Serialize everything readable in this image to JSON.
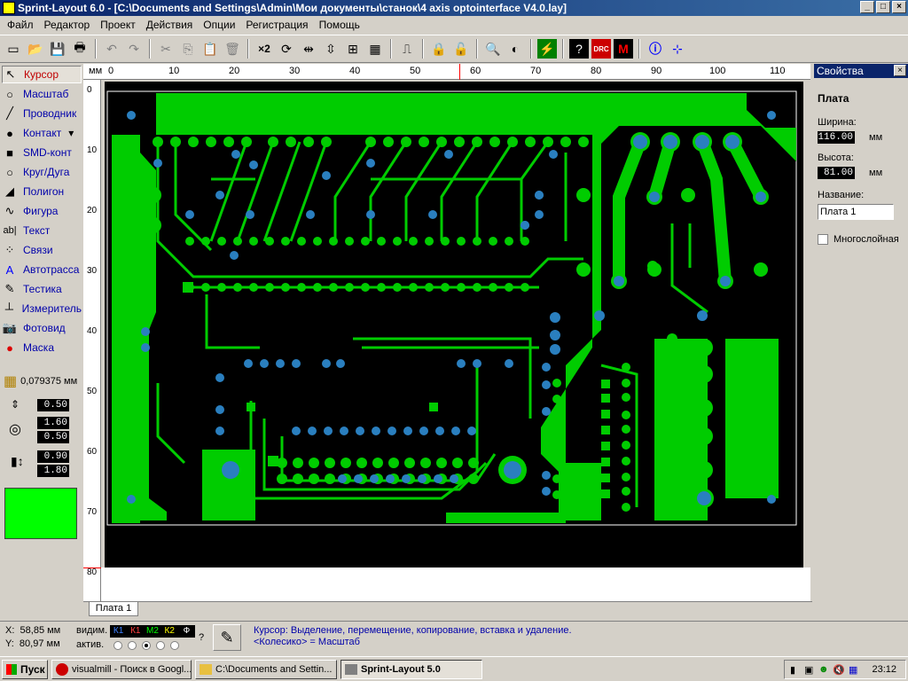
{
  "window": {
    "title": "Sprint-Layout 6.0 - [C:\\Documents and Settings\\Admin\\Мои документы\\станок\\4 axis optointerface V4.0.lay]"
  },
  "menu": [
    "Файл",
    "Редактор",
    "Проект",
    "Действия",
    "Опции",
    "Регистрация",
    "Помощь"
  ],
  "toolbar": [
    "new-icon",
    "open-icon",
    "save-icon",
    "print-icon",
    "undo-icon",
    "redo-icon",
    "cut-icon",
    "copy-icon",
    "paste-icon",
    "delete-icon",
    "x2",
    "rotate-icon",
    "mirror-h-icon",
    "mirror-v-icon",
    "align-icon",
    "group-icon",
    "fixed-icon",
    "lock-icon",
    "unlock-icon",
    "zoom-icon",
    "contrast-icon",
    "autoroute-icon",
    "photoview-icon",
    "drc-icon",
    "macro-icon",
    "info-icon",
    "net-icon"
  ],
  "toolbar_x2": "×2",
  "tools": [
    {
      "label": "Курсор",
      "icon": "cursor-icon"
    },
    {
      "label": "Масштаб",
      "icon": "zoom-icon"
    },
    {
      "label": "Проводник",
      "icon": "track-icon"
    },
    {
      "label": "Контакт",
      "icon": "pad-icon"
    },
    {
      "label": "SMD-конт",
      "icon": "smd-icon"
    },
    {
      "label": "Круг/Дуга",
      "icon": "circle-icon"
    },
    {
      "label": "Полигон",
      "icon": "polygon-icon"
    },
    {
      "label": "Фигура",
      "icon": "shape-icon"
    },
    {
      "label": "Текст",
      "icon": "text-icon"
    },
    {
      "label": "Связи",
      "icon": "connections-icon"
    },
    {
      "label": "Автотрасса",
      "icon": "autoroute-icon"
    },
    {
      "label": "Тестика",
      "icon": "test-icon"
    },
    {
      "label": "Измеритель",
      "icon": "measure-icon"
    },
    {
      "label": "Фотовид",
      "icon": "photoview-icon"
    },
    {
      "label": "Маска",
      "icon": "mask-icon"
    }
  ],
  "grid": "0,079375 мм",
  "track_width": "0.50",
  "pad_outer": "1.60",
  "pad_inner": "0.50",
  "smd_w": "0.90",
  "smd_h": "1.80",
  "active_color": "#00ff00",
  "ruler_unit": "мм",
  "ruler_top_ticks": [
    "0",
    "10",
    "20",
    "30",
    "40",
    "50",
    "60",
    "70",
    "80",
    "90",
    "100",
    "110"
  ],
  "ruler_left_ticks": [
    "0",
    "10",
    "20",
    "30",
    "40",
    "50",
    "60",
    "70",
    "80"
  ],
  "board_tab": "Плата 1",
  "properties": {
    "title": "Свойства",
    "section": "Плата",
    "width_label": "Ширина:",
    "width_value": "116.00",
    "height_label": "Высота:",
    "height_value": "81.00",
    "unit": "мм",
    "name_label": "Название:",
    "name_value": "Плата 1",
    "multilayer_label": "Многослойная"
  },
  "status": {
    "x_label": "X:",
    "x_value": "58,85 мм",
    "y_label": "Y:",
    "y_value": "80,97 мм",
    "visible_label": "видим.",
    "active_label": "актив.",
    "layers": [
      "К1",
      "К1",
      "М2",
      "К2",
      "Ф"
    ],
    "help_char": "?",
    "message_line1": "Курсор: Выделение, перемещение, копирование, вставка и удаление.",
    "message_line2": "<Колесико> = Масштаб"
  },
  "taskbar": {
    "start": "Пуск",
    "tasks": [
      {
        "label": "visualmill - Поиск в Googl...",
        "active": false
      },
      {
        "label": "C:\\Documents and Settin...",
        "active": false
      },
      {
        "label": "Sprint-Layout 5.0",
        "active": true
      }
    ],
    "clock": "23:12"
  }
}
